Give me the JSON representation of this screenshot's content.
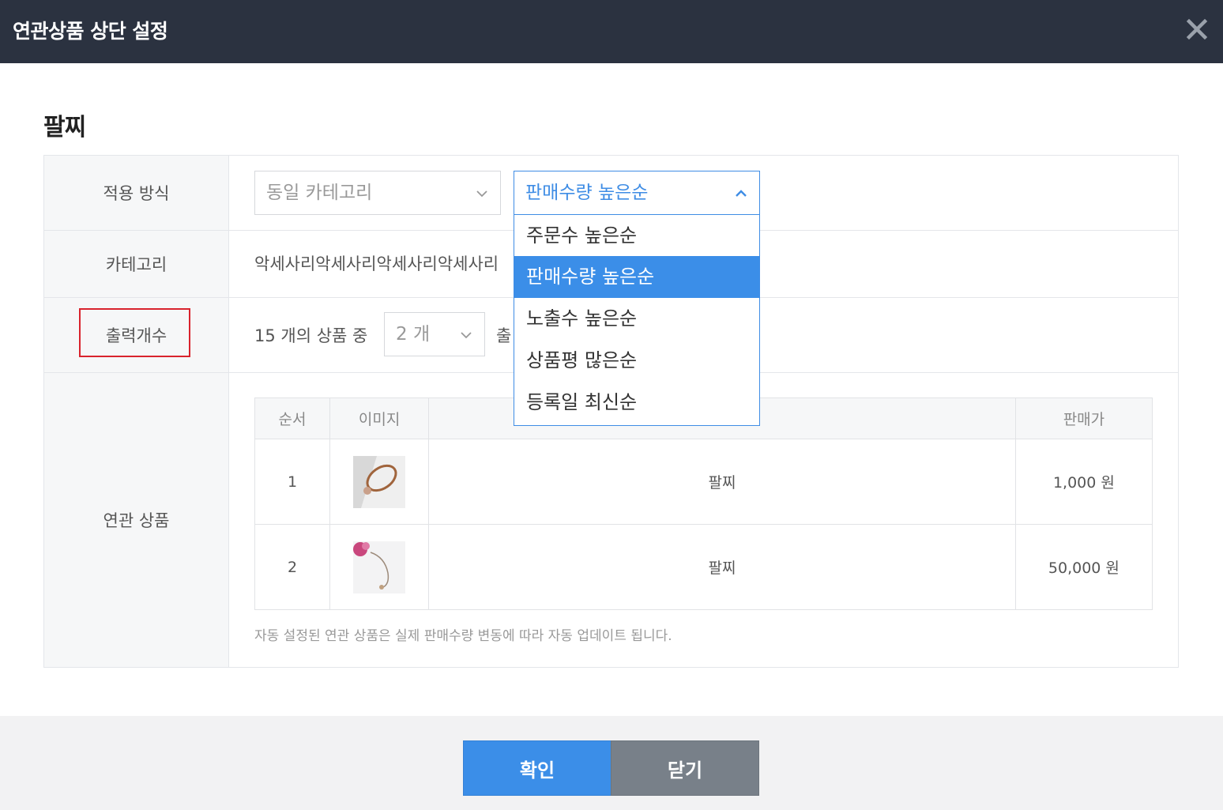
{
  "header": {
    "title": "연관상품 상단 설정",
    "close_icon": "close-icon"
  },
  "section": {
    "title": "팔찌"
  },
  "rows": {
    "apply_method": {
      "label": "적용 방식",
      "category_select": "동일 카테고리",
      "sort_select": "판매수량 높은순",
      "sort_options": [
        "주문수 높은순",
        "판매수량 높은순",
        "노출수 높은순",
        "상품평 많은순",
        "등록일 최신순"
      ],
      "selected_index": 1
    },
    "category": {
      "label": "카테고리",
      "value": "악세사리악세사리악세사리악세사리"
    },
    "output_count": {
      "label": "출력개수",
      "prefix": "15 개의 상품 중",
      "count_select": "2 개",
      "suffix": "출"
    },
    "related": {
      "label": "연관 상품"
    }
  },
  "products": {
    "headers": [
      "순서",
      "이미지",
      "",
      "판매가"
    ],
    "rows": [
      {
        "order": "1",
        "name": "팔찌",
        "price": "1,000 원"
      },
      {
        "order": "2",
        "name": "팔찌",
        "price": "50,000 원"
      }
    ],
    "note": "자동 설정된 연관 상품은 실제 판매수량 변동에 따라 자동 업데이트 됩니다."
  },
  "footer": {
    "confirm": "확인",
    "close": "닫기"
  },
  "colors": {
    "header_bg": "#2b3240",
    "accent": "#3b8ee8",
    "highlight": "#d9232d",
    "close_btn": "#788089"
  }
}
